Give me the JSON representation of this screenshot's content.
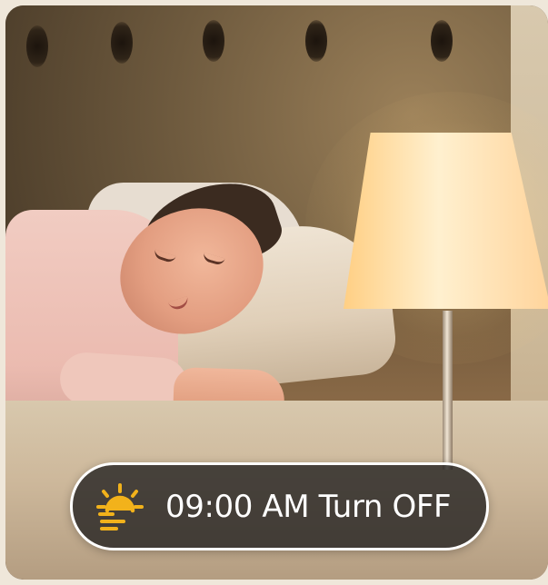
{
  "timer": {
    "label": "09:00 AM Turn OFF",
    "icon": "sunrise-icon",
    "icon_color": "#f2b21b"
  }
}
